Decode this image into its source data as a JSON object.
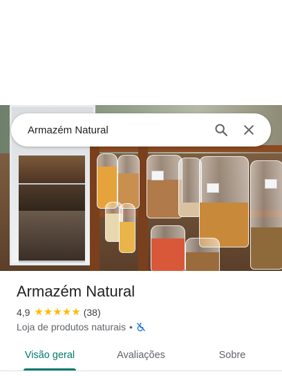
{
  "search": {
    "query": "Armazém Natural",
    "search_icon": "search-icon",
    "clear_icon": "close-icon"
  },
  "photo": {
    "description_icon": "place-photo"
  },
  "place": {
    "name": "Armazém Natural",
    "rating": "4,9",
    "rating_stars": 5,
    "review_count": "(38)",
    "category": "Loja de produtos naturais",
    "separator": "•",
    "accessibility_icon": "wheelchair-not-accessible-icon"
  },
  "tabs": [
    {
      "label": "Visão geral",
      "active": true
    },
    {
      "label": "Avaliações",
      "active": false
    },
    {
      "label": "Sobre",
      "active": false
    }
  ],
  "colors": {
    "accent": "#00796b",
    "star": "#fbbc04",
    "accessibility_icon": "#1a73e8"
  }
}
